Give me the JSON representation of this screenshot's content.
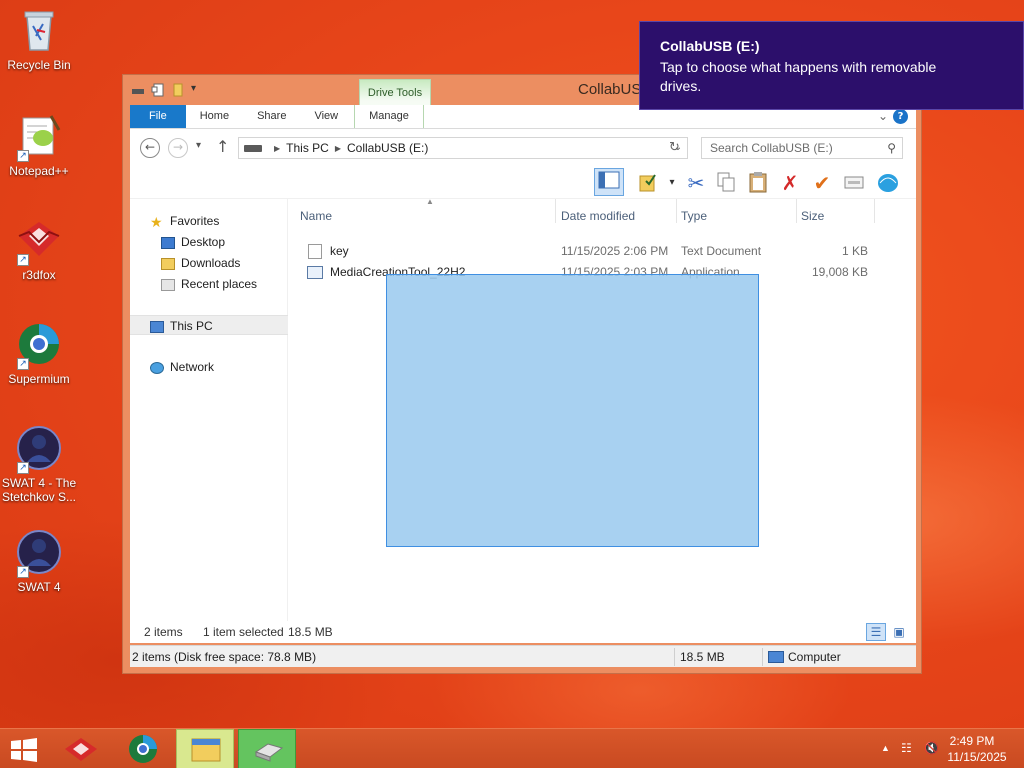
{
  "desktop": {
    "icons": [
      {
        "label": "Recycle Bin",
        "icon": "recycle-bin-icon"
      },
      {
        "label": "Notepad++",
        "icon": "notepad-plus-plus-icon"
      },
      {
        "label": "r3dfox",
        "icon": "r3dfox-icon"
      },
      {
        "label": "Supermium",
        "icon": "supermium-icon"
      },
      {
        "label": "SWAT 4 - The Stetchkov S...",
        "icon": "swat4-stetchkov-icon"
      },
      {
        "label": "SWAT 4",
        "icon": "swat4-icon"
      }
    ]
  },
  "window": {
    "title": "CollabUSB",
    "context_group": "Drive Tools",
    "tabs": [
      "File",
      "Home",
      "Share",
      "View",
      "Manage"
    ],
    "breadcrumb": [
      "This PC",
      "CollabUSB (E:)"
    ],
    "search_placeholder": "Search CollabUSB (E:)"
  },
  "navpane": {
    "items": [
      "Favorites",
      "Desktop",
      "Downloads",
      "Recent places",
      "This PC",
      "Network"
    ]
  },
  "files": {
    "columns": [
      "Name",
      "Date modified",
      "Type",
      "Size"
    ],
    "rows": [
      {
        "name": "key",
        "date": "11/15/2025 2:06 PM",
        "type": "Text Document",
        "size": "1 KB"
      },
      {
        "name": "MediaCreationTool_22H2",
        "date": "11/15/2025 2:03 PM",
        "type": "Application",
        "size": "19,008 KB"
      }
    ]
  },
  "status": {
    "items_count": "2 items",
    "selected": "1 item selected",
    "selected_size": "18.5 MB",
    "bottom_left": "2 items (Disk free space: 78.8 MB)",
    "bottom_size": "18.5 MB",
    "bottom_location": "Computer"
  },
  "toast": {
    "title": "CollabUSB (E:)",
    "body": "Tap to choose what happens with removable drives."
  },
  "taskbar": {
    "time": "2:49 PM",
    "date": "11/15/2025"
  },
  "colors": {
    "wallpaper": "#e8461a",
    "toast_bg": "#2c0f6b",
    "file_tab": "#1979ca",
    "taskbar": "#c94a21"
  }
}
